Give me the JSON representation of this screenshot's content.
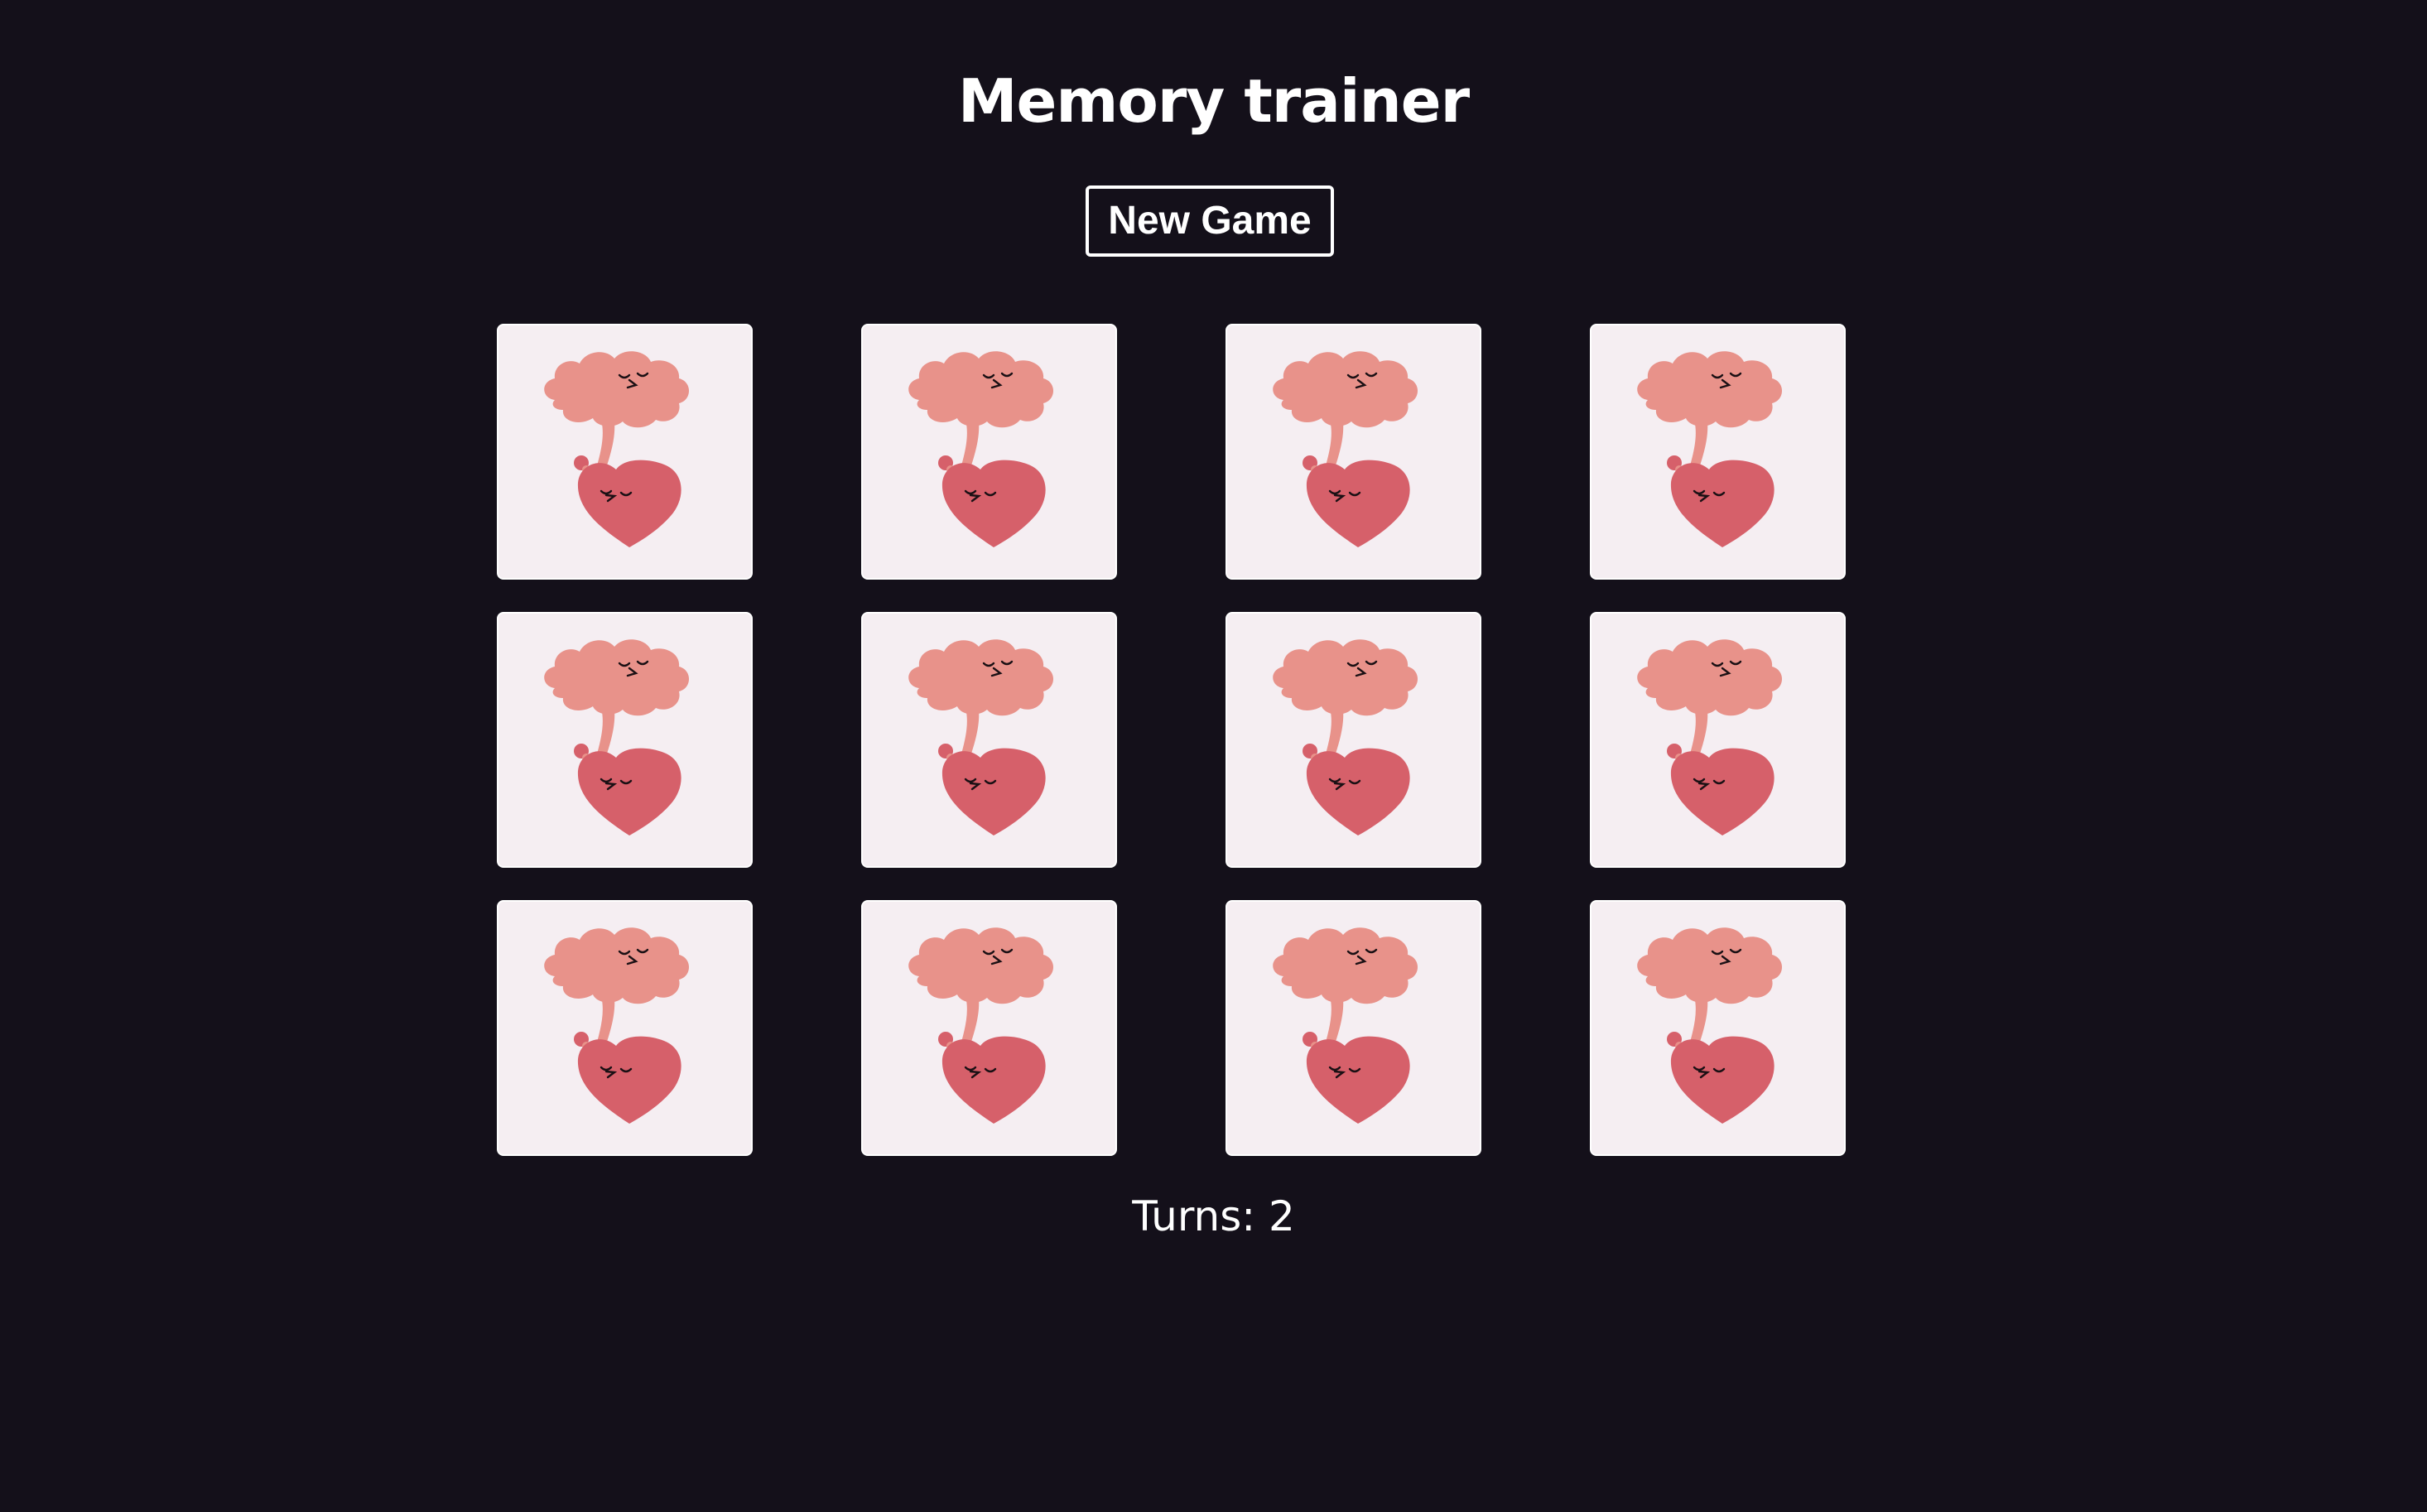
{
  "header": {
    "title": "Memory trainer"
  },
  "controls": {
    "new_game_label": "New Game"
  },
  "board": {
    "rows": 3,
    "columns": 4,
    "cards": [
      {
        "state": "face-down",
        "icon": "brain-heart-icon"
      },
      {
        "state": "face-down",
        "icon": "brain-heart-icon"
      },
      {
        "state": "face-down",
        "icon": "brain-heart-icon"
      },
      {
        "state": "face-down",
        "icon": "brain-heart-icon"
      },
      {
        "state": "face-down",
        "icon": "brain-heart-icon"
      },
      {
        "state": "face-down",
        "icon": "brain-heart-icon"
      },
      {
        "state": "face-down",
        "icon": "brain-heart-icon"
      },
      {
        "state": "face-down",
        "icon": "brain-heart-icon"
      },
      {
        "state": "face-down",
        "icon": "brain-heart-icon"
      },
      {
        "state": "face-down",
        "icon": "brain-heart-icon"
      },
      {
        "state": "face-down",
        "icon": "brain-heart-icon"
      },
      {
        "state": "face-down",
        "icon": "brain-heart-icon"
      }
    ]
  },
  "status": {
    "turns_text": "Turns: 2"
  },
  "colors": {
    "background": "#14101a",
    "card_face": "#f5eef2",
    "brain": "#e8928a",
    "heart": "#d6606a",
    "text": "#ffffff"
  }
}
